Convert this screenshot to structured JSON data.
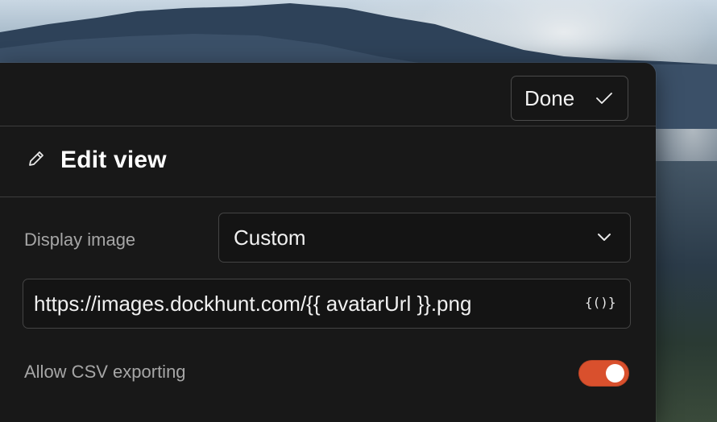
{
  "panel": {
    "title": "Edit view",
    "title_icon": "pencil-icon",
    "done_button": {
      "label": "Done",
      "icon": "check-icon"
    }
  },
  "fields": {
    "display_image": {
      "label": "Display image",
      "selected": "Custom",
      "icon": "chevron-down-icon"
    },
    "image_url": {
      "value": "https://images.dockhunt.com/{{ avatarUrl }}.png",
      "variable_button": "{()}"
    },
    "csv_export": {
      "label": "Allow CSV exporting",
      "enabled": true
    }
  },
  "colors": {
    "panel_bg": "#181818",
    "toggle_on": "#d9502d",
    "label": "#a6a6a6",
    "text": "#f0f0f0"
  }
}
